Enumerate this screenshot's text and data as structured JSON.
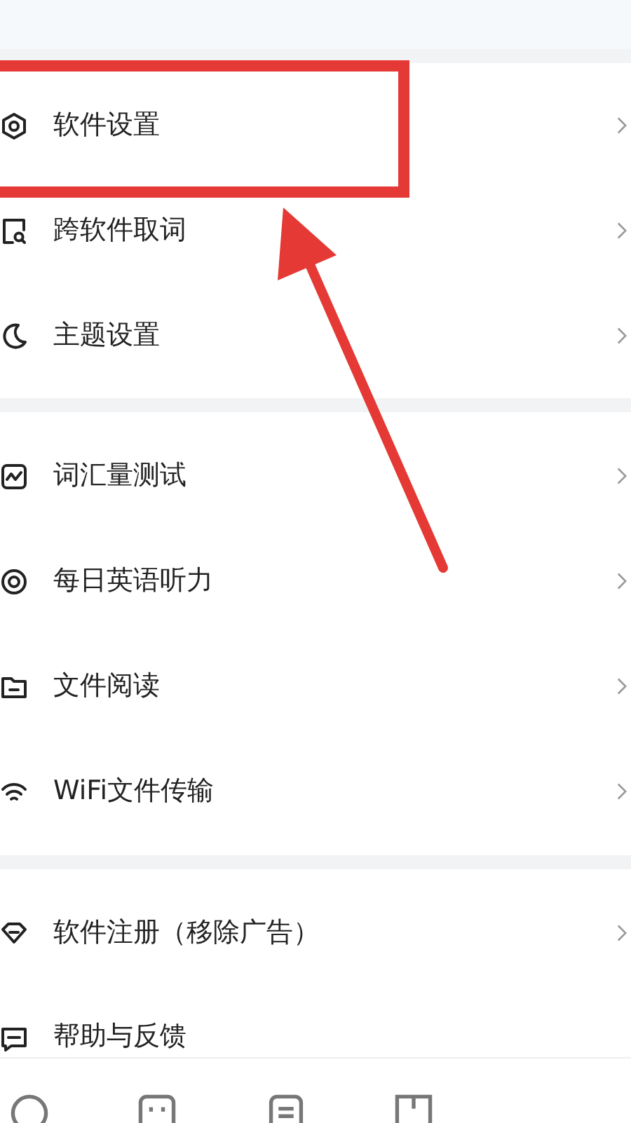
{
  "groups": [
    {
      "items": [
        {
          "kind": "hexagon",
          "label": "软件设置",
          "chevron": true
        },
        {
          "kind": "search-doc",
          "label": "跨软件取词",
          "chevron": true
        },
        {
          "kind": "moon",
          "label": "主题设置",
          "chevron": true
        }
      ]
    },
    {
      "items": [
        {
          "kind": "chart",
          "label": "词汇量测试",
          "chevron": true
        },
        {
          "kind": "target",
          "label": "每日英语听力",
          "chevron": true
        },
        {
          "kind": "folder",
          "label": "文件阅读",
          "chevron": true
        },
        {
          "kind": "wifi",
          "label": "WiFi文件传输",
          "chevron": true
        }
      ]
    },
    {
      "items": [
        {
          "kind": "shield",
          "label": "软件注册（移除广告）",
          "chevron": true
        },
        {
          "kind": "message",
          "label": "帮助与反馈",
          "chevron": false
        }
      ]
    }
  ],
  "bottom_nav": [
    {
      "kind": "circle"
    },
    {
      "kind": "face"
    },
    {
      "kind": "doc"
    },
    {
      "kind": "book"
    }
  ]
}
